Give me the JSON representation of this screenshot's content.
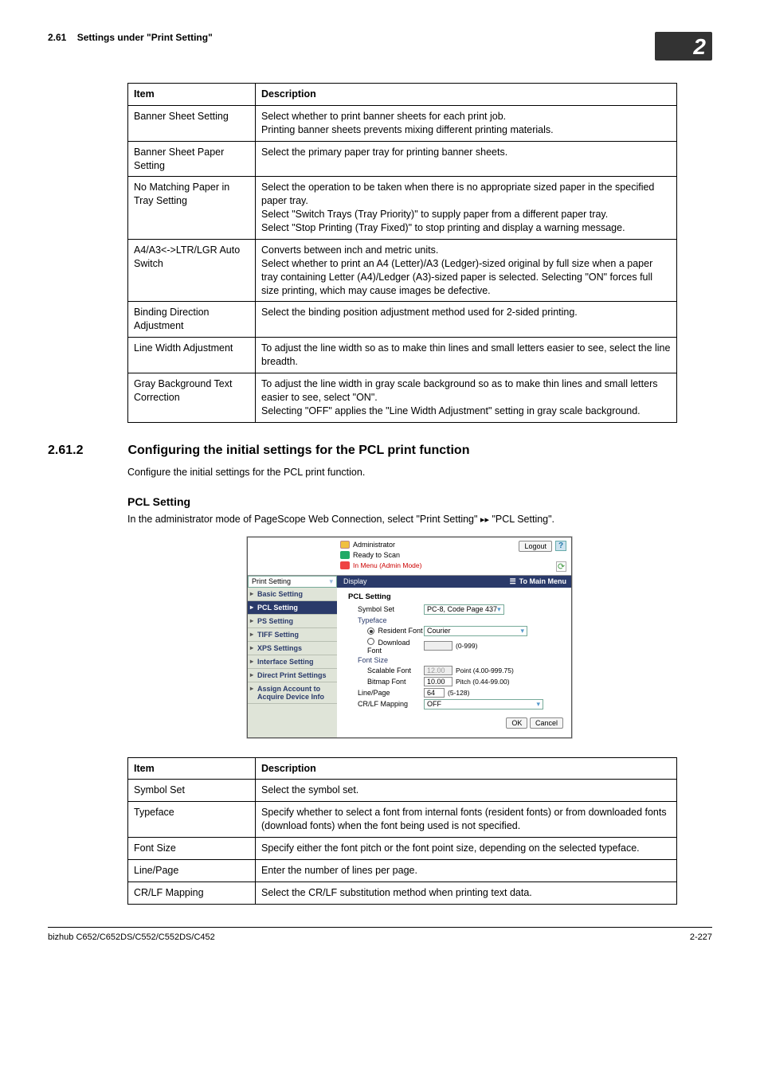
{
  "header": {
    "section_num": "2.61",
    "section_title": "Settings under \"Print Setting\"",
    "chapter_num": "2"
  },
  "table1": {
    "h1": "Item",
    "h2": "Description",
    "rows": [
      {
        "item": "Banner Sheet Setting",
        "desc": "Select whether to print banner sheets for each print job.\nPrinting banner sheets prevents mixing different printing materials."
      },
      {
        "item": "Banner Sheet Paper Setting",
        "desc": "Select the primary paper tray for printing banner sheets."
      },
      {
        "item": "No Matching Paper in Tray Setting",
        "desc": "Select the operation to be taken when there is no appropriate sized paper in the specified paper tray.\nSelect \"Switch Trays (Tray Priority)\" to supply paper from a different paper tray.\nSelect \"Stop Printing (Tray Fixed)\" to stop printing and display a warning message."
      },
      {
        "item": "A4/A3<->LTR/LGR Auto Switch",
        "desc": "Converts between inch and metric units.\nSelect whether to print an A4 (Letter)/A3 (Ledger)-sized original by full size when a paper tray containing Letter (A4)/Ledger (A3)-sized paper is selected. Selecting \"ON\" forces full size printing, which may cause images be defective."
      },
      {
        "item": "Binding Direction Adjustment",
        "desc": "Select the binding position adjustment method used for 2-sided printing."
      },
      {
        "item": "Line Width Adjustment",
        "desc": "To adjust the line width so as to make thin lines and small letters easier to see, select the line breadth."
      },
      {
        "item": "Gray Background Text Correction",
        "desc": "To adjust the line width in gray scale background so as to make thin lines and small letters easier to see, select \"ON\".\nSelecting \"OFF\" applies the \"Line Width Adjustment\" setting in gray scale background."
      }
    ]
  },
  "sec": {
    "num": "2.61.2",
    "title": "Configuring the initial settings for the PCL print function",
    "intro": "Configure the initial settings for the PCL print function.",
    "sub_title": "PCL Setting",
    "sub_intro_a": "In the administrator mode of PageScope Web Connection, select \"Print Setting\" ",
    "sub_intro_b": " \"PCL Setting\"."
  },
  "shot": {
    "admin": "Administrator",
    "logout": "Logout",
    "ready": "Ready to Scan",
    "in_menu": "In Menu (Admin Mode)",
    "dropdown": "Print Setting",
    "display": "Display",
    "to_main": "To Main Menu",
    "sb": [
      "Basic Setting",
      "PCL Setting",
      "PS Setting",
      "TIFF Setting",
      "XPS Settings",
      "Interface Setting",
      "Direct Print Settings",
      "Assign Account to Acquire Device Info"
    ],
    "panel_title": "PCL Setting",
    "rows": {
      "symbol_lbl": "Symbol Set",
      "symbol_val": "PC-8, Code Page 437",
      "typeface_lbl": "Typeface",
      "resident_lbl": "Resident Font",
      "resident_val": "Courier",
      "download_lbl": "Download Font",
      "download_range": "(0-999)",
      "fontsize_lbl": "Font Size",
      "scalable_lbl": "Scalable Font",
      "scalable_val": "12.00",
      "scalable_range": "Point  (4.00-999.75)",
      "bitmap_lbl": "Bitmap Font",
      "bitmap_val": "10.00",
      "bitmap_range": "Pitch  (0.44-99.00)",
      "linepage_lbl": "Line/Page",
      "linepage_val": "64",
      "linepage_range": "(5-128)",
      "crlf_lbl": "CR/LF Mapping",
      "crlf_val": "OFF"
    },
    "ok": "OK",
    "cancel": "Cancel"
  },
  "table2": {
    "h1": "Item",
    "h2": "Description",
    "rows": [
      {
        "item": "Symbol Set",
        "desc": "Select the symbol set."
      },
      {
        "item": "Typeface",
        "desc": "Specify whether to select a font from internal fonts (resident fonts) or from downloaded fonts (download fonts) when the font being used is not specified."
      },
      {
        "item": "Font Size",
        "desc": "Specify either the font pitch or the font point size, depending on the selected typeface."
      },
      {
        "item": "Line/Page",
        "desc": "Enter the number of lines per page."
      },
      {
        "item": "CR/LF Mapping",
        "desc": "Select the CR/LF substitution method when printing text data."
      }
    ]
  },
  "footer": {
    "left": "bizhub C652/C652DS/C552/C552DS/C452",
    "right": "2-227"
  }
}
